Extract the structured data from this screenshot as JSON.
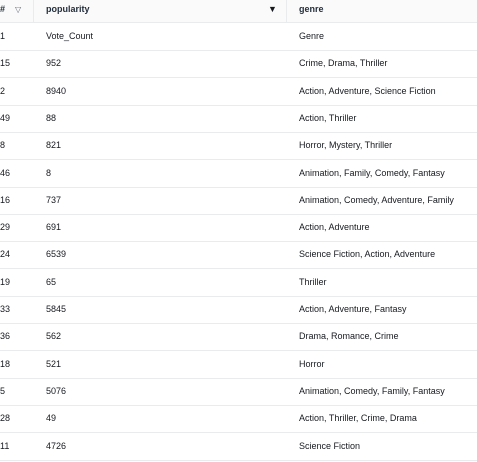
{
  "columns": {
    "index": "#",
    "popularity": "popularity",
    "genre": "genre"
  },
  "icons": {
    "index_sort": "sort-caret-down-outline-icon",
    "popularity_sort": "sort-caret-down-filled-icon"
  },
  "rows": [
    {
      "index": "1",
      "popularity": "Vote_Count",
      "genre": "Genre"
    },
    {
      "index": "15",
      "popularity": "952",
      "genre": "Crime, Drama, Thriller"
    },
    {
      "index": "2",
      "popularity": "8940",
      "genre": "Action, Adventure, Science Fiction"
    },
    {
      "index": "49",
      "popularity": "88",
      "genre": "Action, Thriller"
    },
    {
      "index": "8",
      "popularity": "821",
      "genre": "Horror, Mystery, Thriller"
    },
    {
      "index": "46",
      "popularity": "8",
      "genre": "Animation, Family, Comedy, Fantasy"
    },
    {
      "index": "16",
      "popularity": "737",
      "genre": "Animation, Comedy, Adventure, Family"
    },
    {
      "index": "29",
      "popularity": "691",
      "genre": "Action, Adventure"
    },
    {
      "index": "24",
      "popularity": "6539",
      "genre": "Science Fiction, Action, Adventure"
    },
    {
      "index": "19",
      "popularity": "65",
      "genre": "Thriller"
    },
    {
      "index": "33",
      "popularity": "5845",
      "genre": "Action, Adventure, Fantasy"
    },
    {
      "index": "36",
      "popularity": "562",
      "genre": "Drama, Romance, Crime"
    },
    {
      "index": "18",
      "popularity": "521",
      "genre": "Horror"
    },
    {
      "index": "5",
      "popularity": "5076",
      "genre": "Animation, Comedy, Family, Fantasy"
    },
    {
      "index": "28",
      "popularity": "49",
      "genre": "Action, Thriller, Crime, Drama"
    },
    {
      "index": "11",
      "popularity": "4726",
      "genre": "Science Fiction"
    }
  ]
}
